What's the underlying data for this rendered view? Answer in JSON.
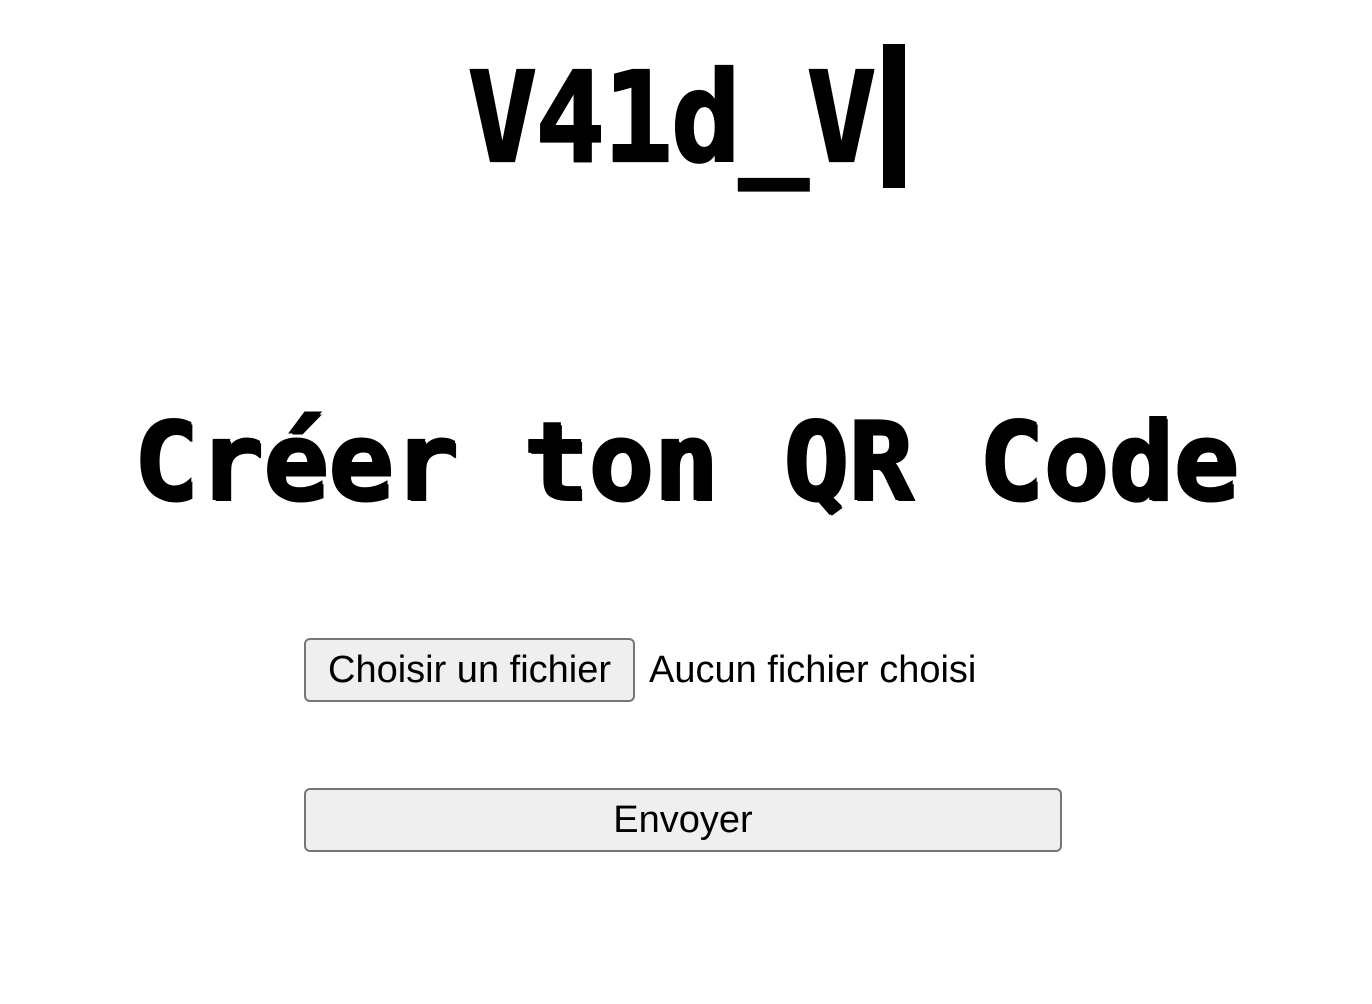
{
  "header": {
    "logo_text": "V41d_V"
  },
  "main": {
    "title": "Créer ton QR Code",
    "file_input": {
      "button_label": "Choisir un fichier",
      "status_text": "Aucun fichier choisi"
    },
    "submit_label": "Envoyer"
  }
}
